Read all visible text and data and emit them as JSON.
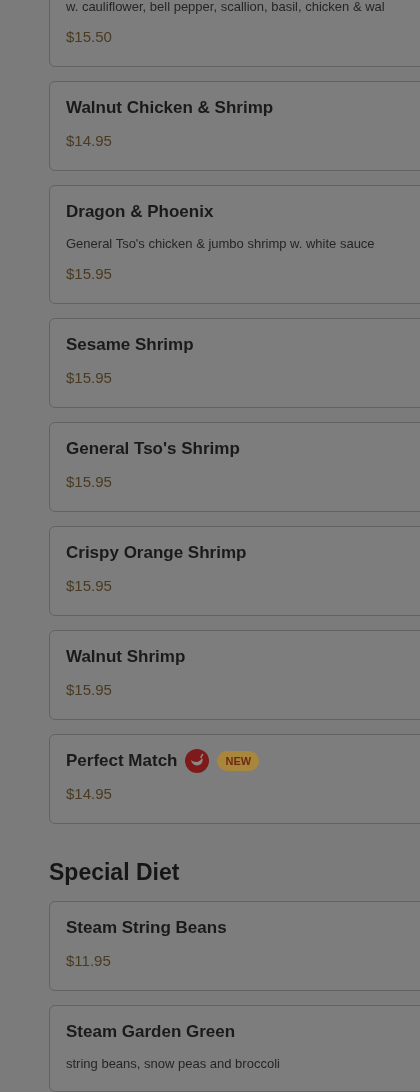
{
  "sections": [
    {
      "items": [
        {
          "description": "w. cauliflower, bell pepper, scallion, basil, chicken & wal",
          "price": "$15.50"
        },
        {
          "name": "Walnut Chicken & Shrimp",
          "price": "$14.95"
        },
        {
          "name": "Dragon & Phoenix",
          "description": "General Tso's chicken & jumbo shrimp w. white sauce",
          "price": "$15.95"
        },
        {
          "name": "Sesame Shrimp",
          "price": "$15.95"
        },
        {
          "name": "General Tso's Shrimp",
          "price": "$15.95"
        },
        {
          "name": "Crispy Orange Shrimp",
          "price": "$15.95"
        },
        {
          "name": "Walnut Shrimp",
          "price": "$15.95"
        },
        {
          "name": "Perfect Match",
          "spicy": true,
          "badge": "NEW",
          "price": "$14.95"
        }
      ]
    },
    {
      "title": "Special Diet",
      "items": [
        {
          "name": "Steam String Beans",
          "price": "$11.95"
        },
        {
          "name": "Steam Garden Green",
          "description": "string beans, snow peas and broccoli"
        }
      ]
    }
  ]
}
